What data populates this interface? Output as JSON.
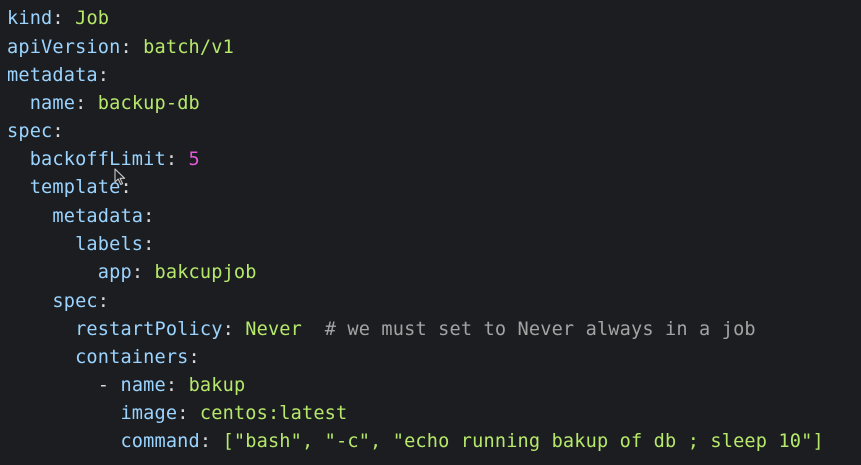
{
  "editor": {
    "lines": [
      {
        "indent": "",
        "key": "kind",
        "value": "Job",
        "value_type": "val"
      },
      {
        "indent": "",
        "key": "apiVersion",
        "value": "batch/v1",
        "value_type": "val"
      },
      {
        "indent": "",
        "key": "metadata",
        "value": "",
        "value_type": "val"
      },
      {
        "indent": "  ",
        "key": "name",
        "value": "backup-db",
        "value_type": "val"
      },
      {
        "indent": "",
        "key": "spec",
        "value": "",
        "value_type": "val"
      },
      {
        "indent": "  ",
        "key": "backoffLimit",
        "value": "5",
        "value_type": "num"
      },
      {
        "indent": "  ",
        "key": "template",
        "value": "",
        "value_type": "val"
      },
      {
        "indent": "    ",
        "key": "metadata",
        "value": "",
        "value_type": "val"
      },
      {
        "indent": "      ",
        "key": "labels",
        "value": "",
        "value_type": "val"
      },
      {
        "indent": "        ",
        "key": "app",
        "value": "bakcupjob",
        "value_type": "val"
      },
      {
        "indent": "    ",
        "key": "spec",
        "value": "",
        "value_type": "val"
      },
      {
        "indent": "      ",
        "key": "restartPolicy",
        "value": "Never",
        "value_type": "val",
        "comment": "  # we must set to Never always in a job"
      },
      {
        "indent": "      ",
        "key": "containers",
        "value": "",
        "value_type": "val"
      },
      {
        "indent": "        ",
        "dash": "- ",
        "key": "name",
        "value": "bakup",
        "value_type": "val"
      },
      {
        "indent": "          ",
        "key": "image",
        "value": "centos:latest",
        "value_type": "val"
      },
      {
        "indent": "          ",
        "key": "command",
        "value": "[\"bash\", \"-c\", \"echo running bakup of db ; sleep 10\"]",
        "value_type": "val"
      }
    ]
  },
  "colors": {
    "background": "#1b1d21",
    "key": "#9bd4ff",
    "string_value": "#b6e86a",
    "number_value": "#e25ad8",
    "comment": "#a3a3a3"
  },
  "icons": {
    "cursor": "mouse-pointer-icon"
  }
}
